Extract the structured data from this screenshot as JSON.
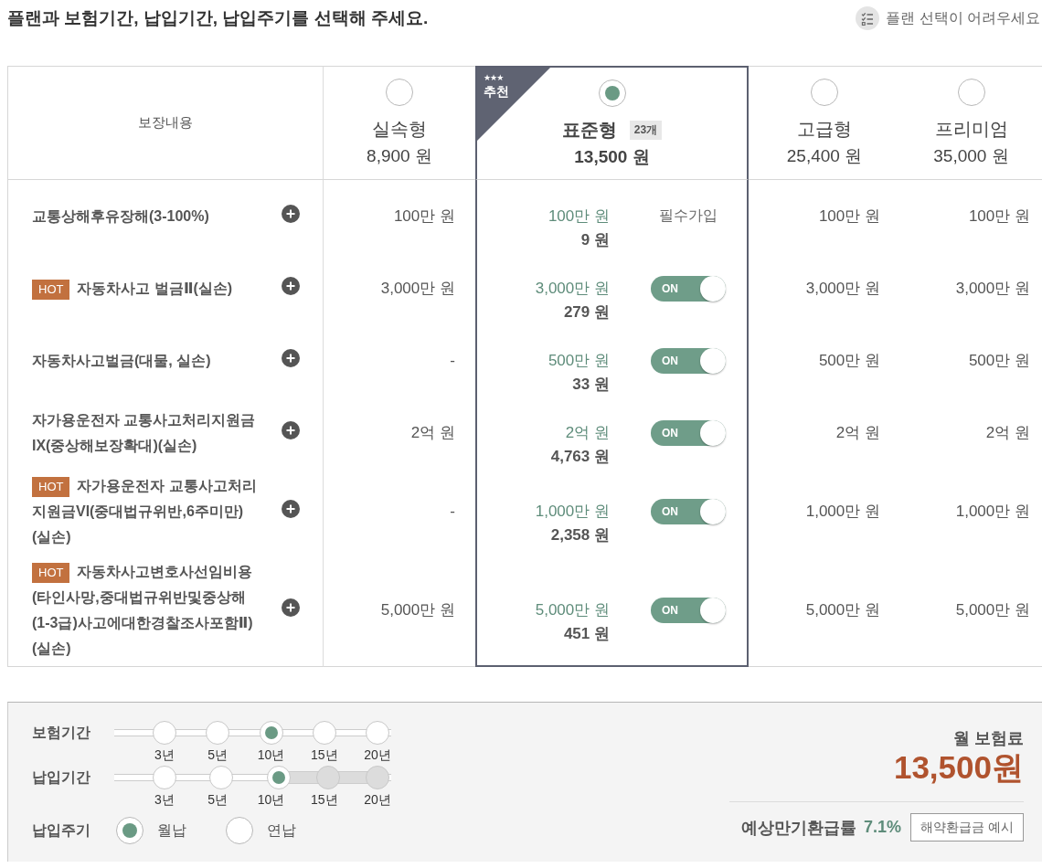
{
  "title": "플랜과 보험기간, 납입기간, 납입주기를 선택해 주세요.",
  "help_link": {
    "label": "플랜 선택이 어려우세요"
  },
  "plan_table": {
    "coverage_heading": "보장내용",
    "plans": [
      {
        "name": "실속형",
        "price": "8,900 원",
        "selected": false
      },
      {
        "name": "표준형",
        "price": "13,500 원",
        "selected": true,
        "count": "23개",
        "ribbon": {
          "mark": "★★★",
          "label": "추천"
        }
      },
      {
        "name": "고급형",
        "price": "25,400 원",
        "selected": false
      },
      {
        "name": "프리미엄",
        "price": "35,000 원",
        "selected": false
      }
    ],
    "rows": [
      {
        "label": "교통상해후유장해(3-100%)",
        "amounts": [
          "100만 원",
          "100만 원",
          "100만 원",
          "100만 원"
        ],
        "premium": "9 원",
        "control": {
          "kind": "required",
          "label": "필수가입"
        }
      },
      {
        "badge": "HOT",
        "label": "자동차사고 벌금Ⅱ(실손)",
        "amounts": [
          "3,000만 원",
          "3,000만 원",
          "3,000만 원",
          "3,000만 원"
        ],
        "premium": "279 원",
        "control": {
          "kind": "switch",
          "on": true,
          "label": "ON"
        }
      },
      {
        "label": "자동차사고벌금(대물, 실손)",
        "amounts": [
          "-",
          "500만 원",
          "500만 원",
          "500만 원"
        ],
        "premium": "33 원",
        "control": {
          "kind": "switch",
          "on": true,
          "label": "ON"
        }
      },
      {
        "label": "자가용운전자 교통사고처리지원금IX(중상해보장확대)(실손)",
        "amounts": [
          "2억 원",
          "2억 원",
          "2억 원",
          "2억 원"
        ],
        "premium": "4,763 원",
        "control": {
          "kind": "switch",
          "on": true,
          "label": "ON"
        }
      },
      {
        "badge": "HOT",
        "label": "자가용운전자 교통사고처리지원금VI(중대법규위반,6주미만)(실손)",
        "amounts": [
          "-",
          "1,000만 원",
          "1,000만 원",
          "1,000만 원"
        ],
        "premium": "2,358 원",
        "control": {
          "kind": "switch",
          "on": true,
          "label": "ON"
        }
      },
      {
        "badge": "HOT",
        "label": "자동차사고변호사선임비용(타인사망,중대법규위반및중상해(1-3급)사고에대한경찰조사포함Ⅱ)(실손)",
        "amounts": [
          "5,000만 원",
          "5,000만 원",
          "5,000만 원",
          "5,000만 원"
        ],
        "premium": "451 원",
        "control": {
          "kind": "switch",
          "on": true,
          "label": "ON"
        }
      }
    ]
  },
  "settings": {
    "steppers": [
      {
        "label": "보험기간",
        "options": [
          {
            "label": "3년",
            "selected": false,
            "disabled": false
          },
          {
            "label": "5년",
            "selected": false,
            "disabled": false
          },
          {
            "label": "10년",
            "selected": true,
            "disabled": false
          },
          {
            "label": "15년",
            "selected": false,
            "disabled": false
          },
          {
            "label": "20년",
            "selected": false,
            "disabled": false
          }
        ]
      },
      {
        "label": "납입기간",
        "options": [
          {
            "label": "3년",
            "selected": false,
            "disabled": false
          },
          {
            "label": "5년",
            "selected": false,
            "disabled": false
          },
          {
            "label": "10년",
            "selected": true,
            "disabled": false
          },
          {
            "label": "15년",
            "selected": false,
            "disabled": true
          },
          {
            "label": "20년",
            "selected": false,
            "disabled": true
          }
        ]
      }
    ],
    "payment_cycle": {
      "label": "납입주기",
      "options": [
        {
          "label": "월납",
          "selected": true
        },
        {
          "label": "연납",
          "selected": false
        }
      ]
    }
  },
  "summary": {
    "monthly_label": "월 보험료",
    "monthly_amount": "13,500원",
    "refund_label": "예상만기환급률",
    "refund_rate": "7.1%",
    "refund_button": "해약환급금 예시"
  }
}
